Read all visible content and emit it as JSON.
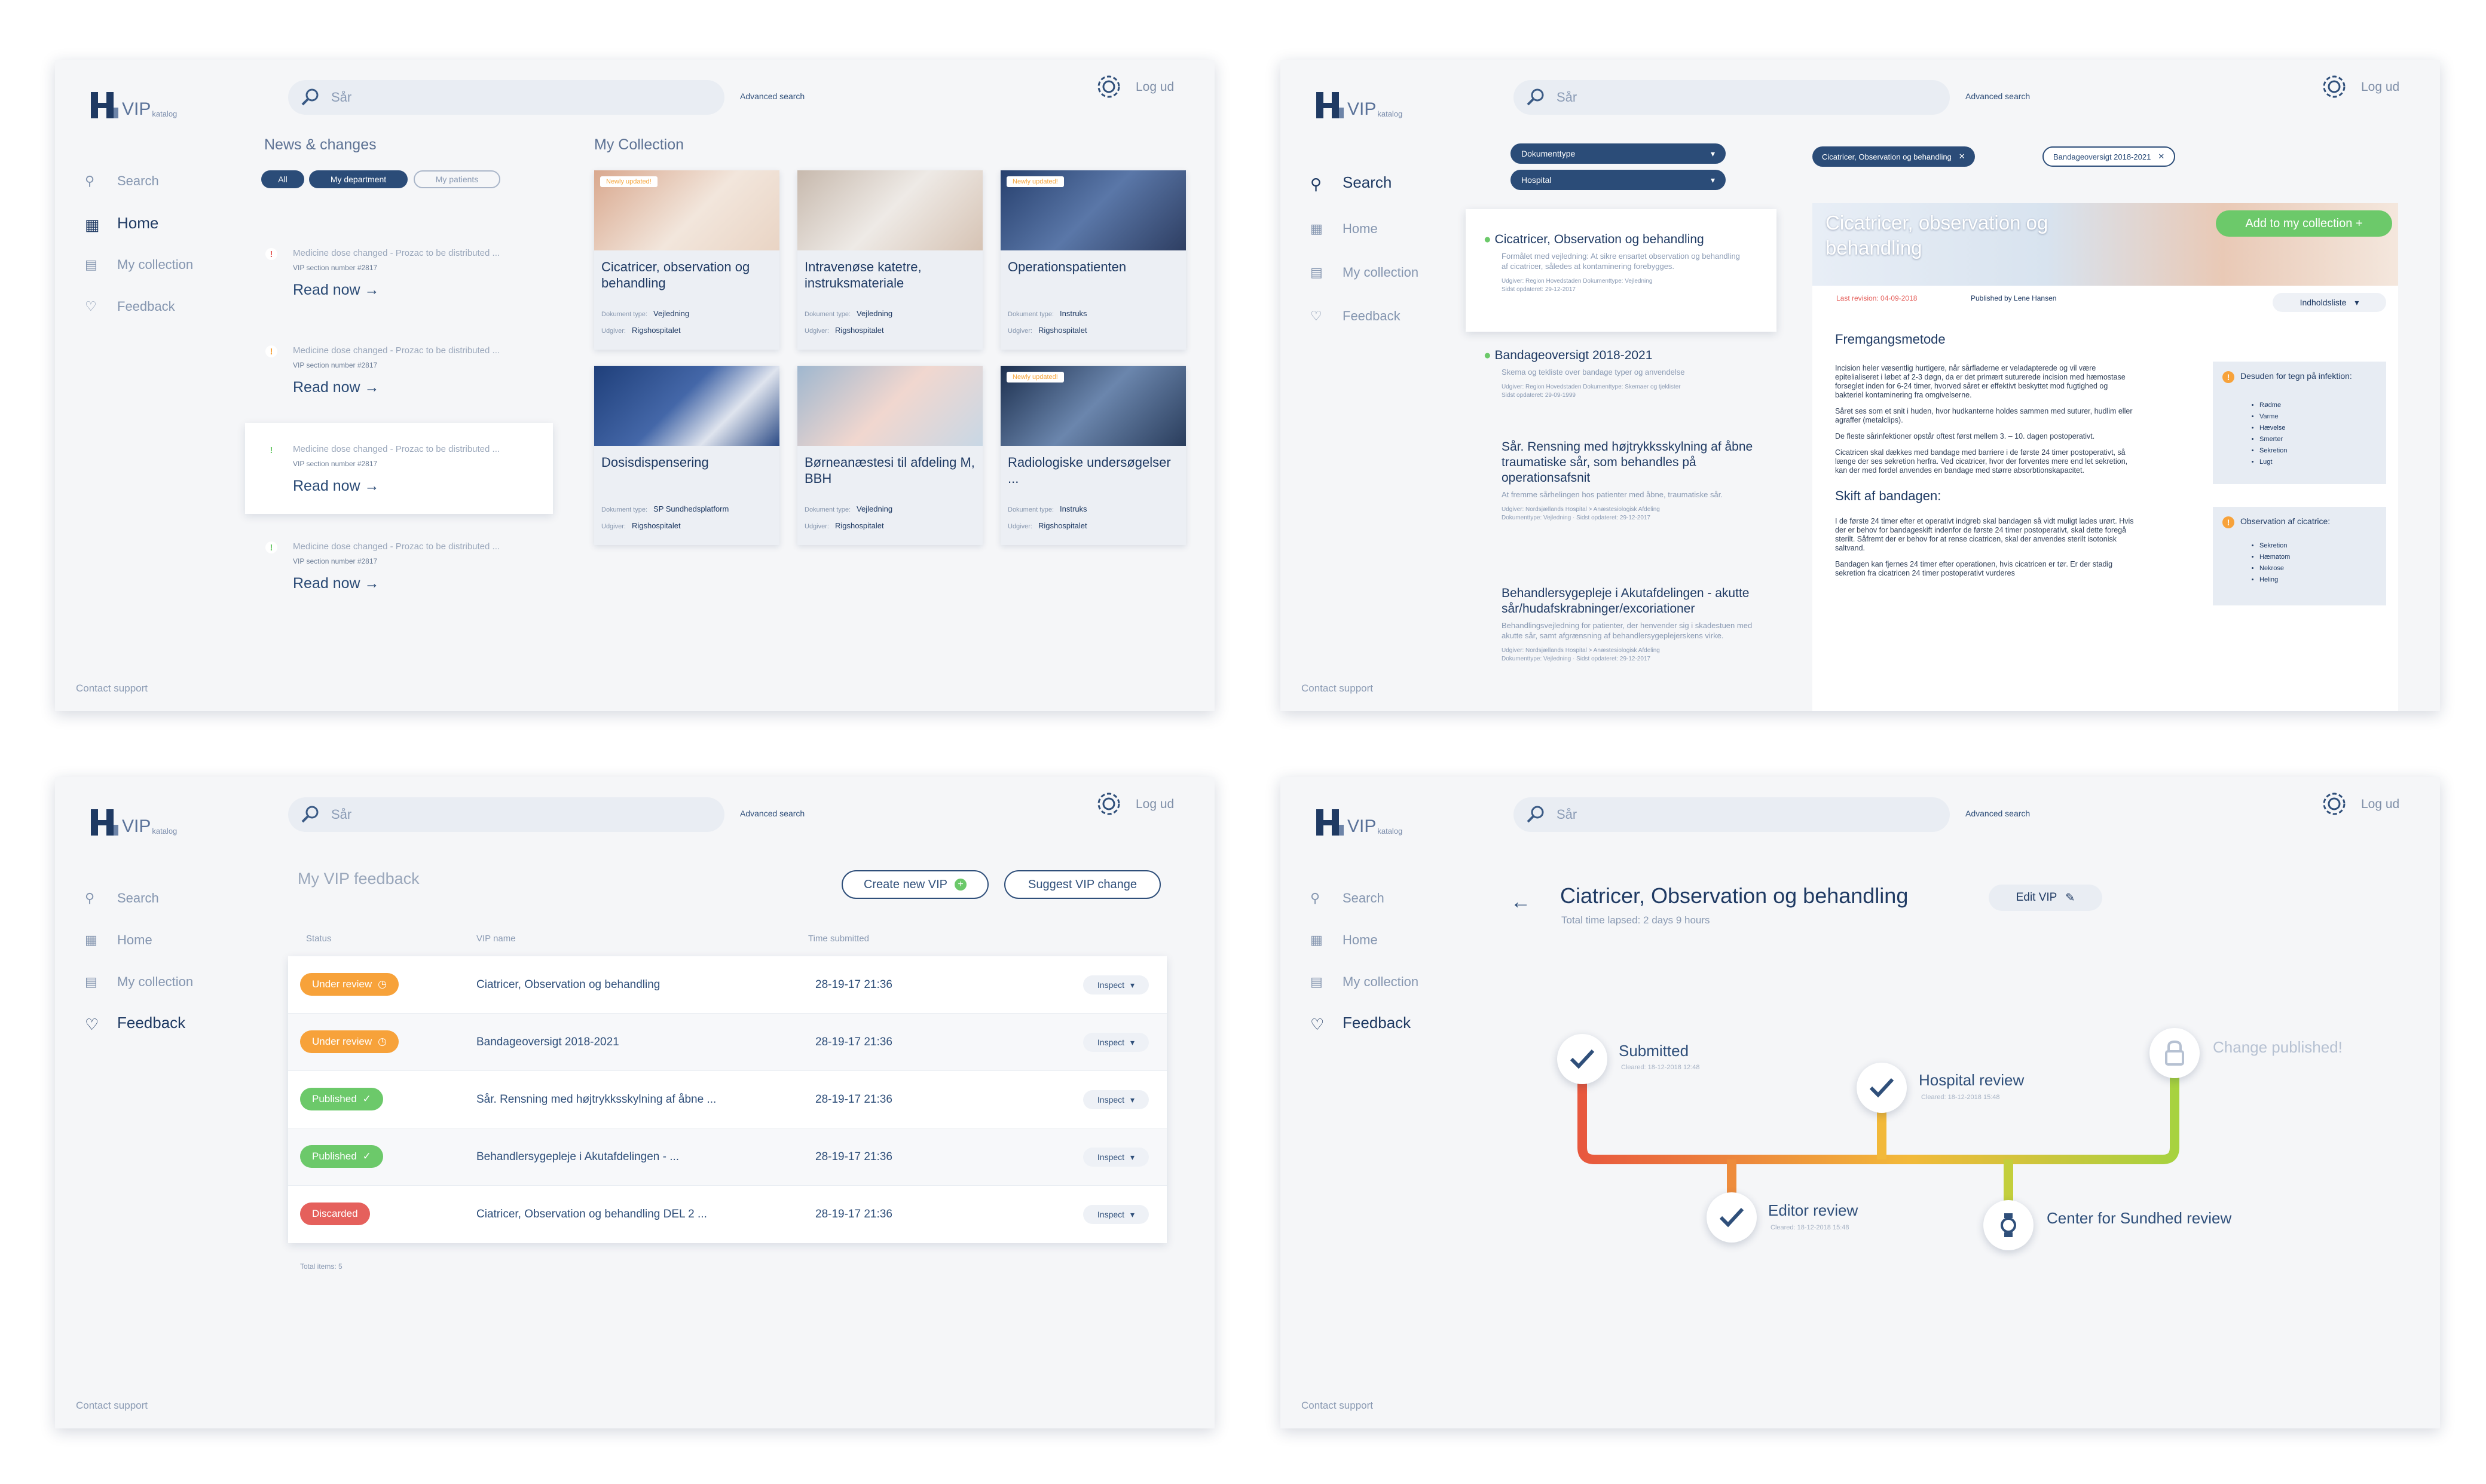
{
  "app": {
    "logo_text": "VIP",
    "logo_sub": "katalog",
    "search_placeholder": "Sår",
    "advanced_search": "Advanced search",
    "logout": "Log ud",
    "contact_support": "Contact support"
  },
  "nav": [
    "Search",
    "Home",
    "My collection",
    "Feedback"
  ],
  "colors": {
    "navy": "#1f3a63",
    "blue": "#2b4c78",
    "orange": "#f7a23a",
    "green": "#6cc96a",
    "red": "#e5605c",
    "gradient_start": "#e8583e",
    "gradient_end": "#a7d23f"
  },
  "screen1": {
    "news_title": "News & changes",
    "filters": [
      "All",
      "My department",
      "My patients"
    ],
    "news": [
      {
        "title": "Medicine dose changed - Prozac to be distributed ...",
        "sub": "VIP section number #2817",
        "read": "Read now →",
        "level": "red"
      },
      {
        "title": "Medicine dose changed - Prozac to be distributed ...",
        "sub": "VIP section number #2817",
        "read": "Read now →",
        "level": "orange"
      },
      {
        "title": "Medicine dose changed - Prozac to be distributed ...",
        "sub": "VIP section number #2817",
        "read": "Read now →",
        "level": "green"
      },
      {
        "title": "Medicine dose changed - Prozac to be distributed ...",
        "sub": "VIP section number #2817",
        "read": "Read now →",
        "level": "green"
      }
    ],
    "collection_title": "My Collection",
    "doc_type_label": "Dokument type:",
    "publisher_label": "Udgiver:",
    "cards": [
      {
        "title": "Cicatricer, observation og behandling",
        "badge": "Newly updated!",
        "type": "Vejledning",
        "publisher": "Rigshospitalet"
      },
      {
        "title": "Intravenøse katetre, instruksmateriale",
        "badge": "",
        "type": "Vejledning",
        "publisher": "Rigshospitalet"
      },
      {
        "title": "Operationspatienten",
        "badge": "Newly updated!",
        "type": "Instruks",
        "publisher": "Rigshospitalet"
      },
      {
        "title": "Dosisdispensering",
        "badge": "",
        "type": "SP Sundhedsplatform",
        "publisher": "Rigshospitalet"
      },
      {
        "title": "Børneanæstesi til afdeling M, BBH",
        "badge": "",
        "type": "Vejledning",
        "publisher": "Rigshospitalet"
      },
      {
        "title": "Radiologiske undersøgelser ...",
        "badge": "Newly updated!",
        "type": "Instruks",
        "publisher": "Rigshospitalet"
      }
    ]
  },
  "screen2": {
    "dropdowns": [
      "Dokumenttype",
      "Hospital"
    ],
    "chips": [
      "Cicatricer, Observation og behandling",
      "Bandageoversigt 2018-2021"
    ],
    "results": [
      {
        "title": "Cicatricer, Observation og behandling",
        "desc": "Formålet med vejledning: At sikre ensartet observation og behandling af cicatricer, således at kontaminering forebygges.",
        "meta": "Udgiver: Region Hovedstaden    Dokumenttype: Vejledning",
        "date": "Sidst opdateret: 29-12-2017",
        "checked": true
      },
      {
        "title": "Bandageoversigt 2018-2021",
        "desc": "Skema og tekliste over bandage typer og anvendelse",
        "meta": "Udgiver: Region Hovedstaden    Dokumenttype: Skemaer og tjeklister",
        "date": "Sidst opdateret: 29-09-1999",
        "checked": true
      },
      {
        "title": "Sår. Rensning med højtrykksskylning af åbne traumatiske sår, som behandles på operationsafsnit",
        "desc": "At fremme sårhelingen hos patienter med åbne, traumatiske sår.",
        "meta": "Udgiver: Nordsjællands Hospital > Anæstesiologisk Afdeling",
        "date": "Dokumenttype: Vejledning · Sidst opdateret: 29-12-2017",
        "checked": false
      },
      {
        "title": "Behandlersygepleje i Akutafdelingen - akutte sår/hudafskrabninger/excoriationer",
        "desc": "Behandlingsvejledning for patienter, der henvender sig i skadestuen med akutte sår, samt afgrænsning af behandlersygeplejerskens virke.",
        "meta": "Udgiver: Nordsjællands Hospital > Anæstesiologisk Afdeling",
        "date": "Dokumenttype: Vejledning · Sidst opdateret: 29-12-2017",
        "checked": false
      }
    ],
    "doc_title": "Cicatricer, observation og behandling",
    "add_button": "Add to my collection  +",
    "last_revision": "Last revision: 04-09-2018",
    "published_by": "Published by Lene Hansen",
    "toc": "Indholdsliste",
    "h1": "Fremgangsmetode",
    "p1": "Incision heler væsentlig hurtigere, når sårfladerne er veladapterede og vil være epitelialiseret i løbet af 2-3 døgn, da er det primært suturerede incision med hæmostase forseglet inden for 6-24 timer, hvorved såret er effektivt beskyttet mod fugtighed og bakteriel kontaminering fra omgivelserne.",
    "p2": "Såret ses som et snit i huden, hvor hudkanterne holdes sammen med suturer, hudlim eller agraffer (metalclips).",
    "p3": "De fleste sårinfektioner opstår oftest først mellem 3. – 10. dagen postoperativt.",
    "p4": "Cicatricen skal dækkes med bandage med barriere i de første 24 timer postoperativt, så længe der ses sekretion herfra. Ved cicatricer, hvor der forventes mere end let sekretion, kan der med fordel anvendes en bandage med større absorbtionskapacitet.",
    "h2": "Skift af bandagen:",
    "p5": "I de første 24 timer efter et operativt indgreb skal bandagen så vidt muligt lades urørt. Hvis der er behov for bandageskift indenfor de første 24 timer postoperativt, skal dette foregå sterilt. Såfremt der er behov for at rense cicatricen, skal der anvendes sterilt isotonisk saltvand.",
    "p6": "Bandagen kan fjernes 24 timer efter operationen, hvis cicatricen er tør. Er der stadig sekretion fra cicatricen 24 timer postoperativt vurderes",
    "tip1_title": "Desuden for tegn på infektion:",
    "tip1_items": [
      "Rødme",
      "Varme",
      "Hævelse",
      "Smerter",
      "Sekretion",
      "Lugt"
    ],
    "tip2_title": "Observation af cicatrice:",
    "tip2_items": [
      "Sekretion",
      "Hæmatom",
      "Nekrose",
      "Heling"
    ]
  },
  "screen3": {
    "title": "My VIP feedback",
    "create_btn": "Create new VIP",
    "suggest_btn": "Suggest VIP change",
    "cols": [
      "Status",
      "VIP name",
      "Time submitted"
    ],
    "inspect": "Inspect",
    "rows": [
      {
        "status": "Under review",
        "color": "#f7a23a",
        "name": "Ciatricer, Observation og behandling",
        "time": "28-19-17   21:36"
      },
      {
        "status": "Under review",
        "color": "#f7a23a",
        "name": "Bandageoversigt 2018-2021",
        "time": "28-19-17   21:36"
      },
      {
        "status": "Published",
        "color": "#6cc96a",
        "name": "Sår. Rensning med højtrykksskylning af åbne ...",
        "time": "28-19-17   21:36"
      },
      {
        "status": "Published",
        "color": "#6cc96a",
        "name": "Behandlersygepleje i Akutafdelingen - ...",
        "time": "28-19-17   21:36"
      },
      {
        "status": "Discarded",
        "color": "#e5605c",
        "name": "Ciatricer, Observation og behandling DEL 2 ...",
        "time": "28-19-17   21:36"
      }
    ],
    "total": "Total items: 5"
  },
  "screen4": {
    "title": "Ciatricer, Observation og behandling",
    "sub": "Total time lapsed: 2 days 9 hours",
    "edit": "Edit VIP",
    "steps": [
      {
        "label": "Submitted",
        "date": "Cleared: 18-12-2018  12:48"
      },
      {
        "label": "Hospital review",
        "date": "Cleared: 18-12-2018  15:48"
      },
      {
        "label": "Change published!",
        "date": ""
      },
      {
        "label": "Editor review",
        "date": "Cleared: 18-12-2018  15:48"
      },
      {
        "label": "Center for Sundhed review",
        "date": ""
      }
    ]
  }
}
